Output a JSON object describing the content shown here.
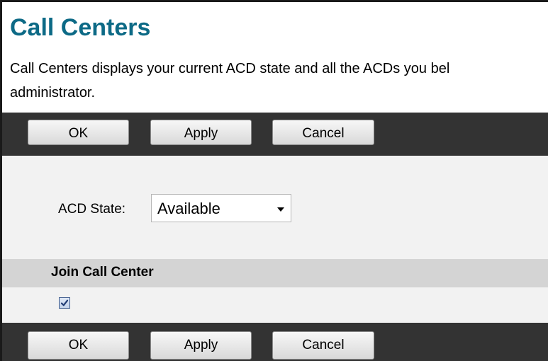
{
  "page": {
    "title": "Call Centers",
    "description_line1": "Call Centers displays your current ACD state and all the ACDs you bel",
    "description_line2": "administrator."
  },
  "toolbar": {
    "ok_label": "OK",
    "apply_label": "Apply",
    "cancel_label": "Cancel"
  },
  "acd": {
    "label": "ACD State:",
    "selected_value": "Available"
  },
  "join_section": {
    "header": "Join Call Center",
    "checked": true,
    "checkbox_icon": "checkmark-icon"
  },
  "colors": {
    "title": "#0d6a86",
    "toolbar_background": "#333333",
    "content_background": "#f2f2f2",
    "section_header_background": "#d4d4d4"
  }
}
